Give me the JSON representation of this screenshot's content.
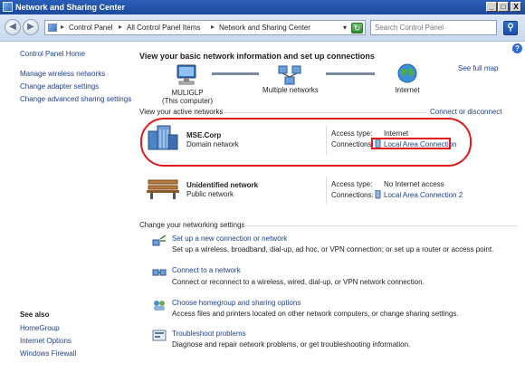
{
  "window": {
    "title": "Network and Sharing Center",
    "min_glyph": "_",
    "max_glyph": "□",
    "close_glyph": "X"
  },
  "address": {
    "breadcrumbs": [
      "Control Panel",
      "All Control Panel Items",
      "Network and Sharing Center"
    ],
    "separator": "▸",
    "search_placeholder": "Search Control Panel",
    "help_glyph": "?"
  },
  "leftnav": {
    "home": "Control Panel Home",
    "links": [
      "Manage wireless networks",
      "Change adapter settings",
      "Change advanced sharing settings"
    ],
    "see_also_title": "See also",
    "see_also": [
      "HomeGroup",
      "Internet Options",
      "Windows Firewall"
    ]
  },
  "main": {
    "heading": "View your basic network information and set up connections",
    "see_full_map": "See full map",
    "map": {
      "computer": "MULIGLP",
      "computer_sub": "(This computer)",
      "middle": "Multiple networks",
      "internet": "Internet"
    },
    "active_label": "View your active networks",
    "connect_link": "Connect or disconnect",
    "networks": [
      {
        "name": "MSE.Corp",
        "type": "Domain network",
        "access_label": "Access type:",
        "access_value": "Internet",
        "conn_label": "Connections:",
        "conn_value": "Local Area Connection"
      },
      {
        "name": "Unidentified network",
        "type": "Public network",
        "access_label": "Access type:",
        "access_value": "No Internet access",
        "conn_label": "Connections:",
        "conn_value": "Local Area Connection 2"
      }
    ],
    "change_label": "Change your networking settings",
    "tasks": [
      {
        "link": "Set up a new connection or network",
        "desc": "Set up a wireless, broadband, dial-up, ad hoc, or VPN connection; or set up a router or access point."
      },
      {
        "link": "Connect to a network",
        "desc": "Connect or reconnect to a wireless, wired, dial-up, or VPN network connection."
      },
      {
        "link": "Choose homegroup and sharing options",
        "desc": "Access files and printers located on other network computers, or change sharing settings."
      },
      {
        "link": "Troubleshoot problems",
        "desc": "Diagnose and repair network problems, or get troubleshooting information."
      }
    ]
  },
  "colors": {
    "link": "#1e3f8f",
    "title_bar": "#2b5eb8",
    "highlight": "#e01a1a"
  }
}
